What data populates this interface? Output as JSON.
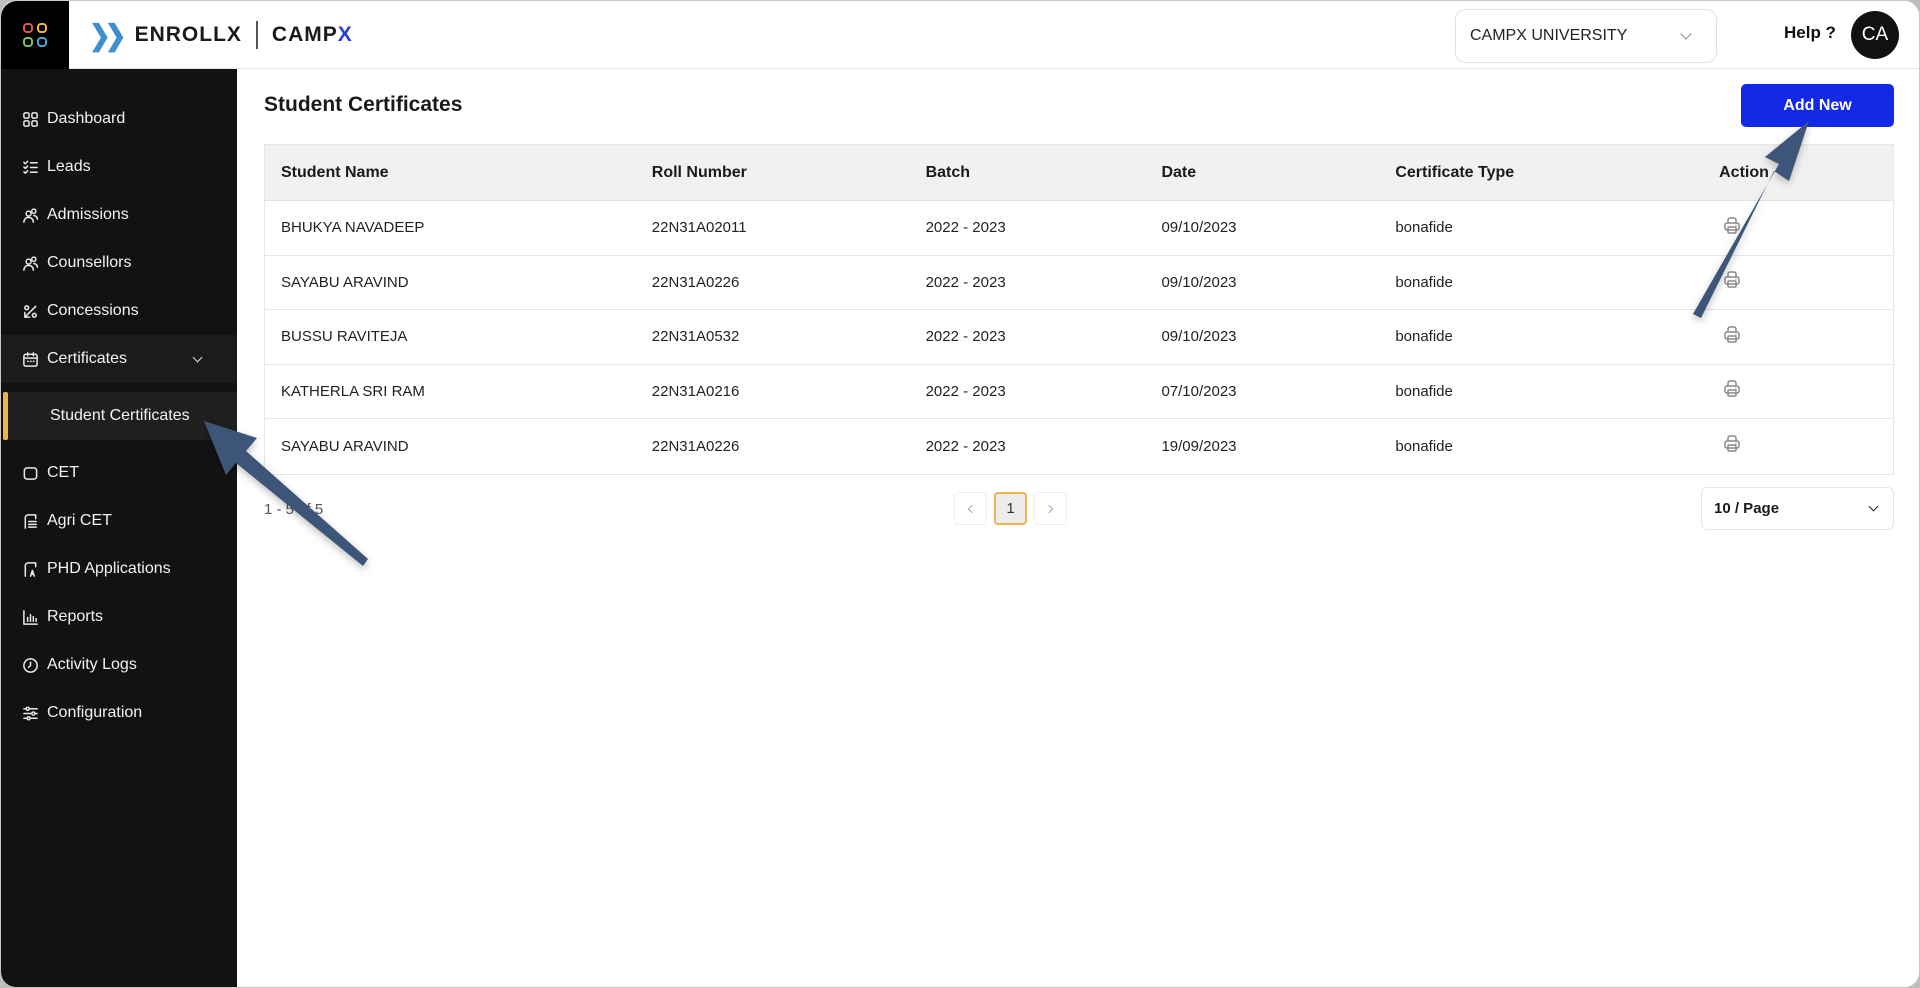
{
  "header": {
    "brand_primary": "ENROLLX",
    "brand_secondary_main": "CAMP",
    "brand_secondary_accent": "X",
    "institution_select": "CAMPX UNIVERSITY",
    "help_label": "Help ?",
    "avatar_initials": "CA"
  },
  "sidebar": {
    "items": [
      {
        "label": "Dashboard",
        "icon": "dashboard-grid-icon"
      },
      {
        "label": "Leads",
        "icon": "checklist-icon"
      },
      {
        "label": "Admissions",
        "icon": "users-icon"
      },
      {
        "label": "Counsellors",
        "icon": "users-icon"
      },
      {
        "label": "Concessions",
        "icon": "percent-icon"
      },
      {
        "label": "Certificates",
        "icon": "calendar-icon",
        "expanded": true
      },
      {
        "label": "Student Certificates",
        "active": true
      },
      {
        "label": "CET",
        "icon": "square-icon"
      },
      {
        "label": "Agri CET",
        "icon": "document-icon"
      },
      {
        "label": "PHD Applications",
        "icon": "document-a-icon"
      },
      {
        "label": "Reports",
        "icon": "bar-chart-icon"
      },
      {
        "label": "Activity Logs",
        "icon": "clock-icon"
      },
      {
        "label": "Configuration",
        "icon": "sliders-icon"
      }
    ]
  },
  "main": {
    "title": "Student Certificates",
    "add_button": "Add New",
    "table": {
      "columns": [
        "Student Name",
        "Roll Number",
        "Batch",
        "Date",
        "Certificate Type",
        "Action"
      ],
      "rows": [
        {
          "name": "BHUKYA NAVADEEP",
          "roll": "22N31A02011",
          "batch": "2022 - 2023",
          "date": "09/10/2023",
          "type": "bonafide"
        },
        {
          "name": "SAYABU ARAVIND",
          "roll": "22N31A0226",
          "batch": "2022 - 2023",
          "date": "09/10/2023",
          "type": "bonafide"
        },
        {
          "name": "BUSSU RAVITEJA",
          "roll": "22N31A0532",
          "batch": "2022 - 2023",
          "date": "09/10/2023",
          "type": "bonafide"
        },
        {
          "name": "KATHERLA SRI RAM",
          "roll": "22N31A0216",
          "batch": "2022 - 2023",
          "date": "07/10/2023",
          "type": "bonafide"
        },
        {
          "name": "SAYABU ARAVIND",
          "roll": "22N31A0226",
          "batch": "2022 - 2023",
          "date": "19/09/2023",
          "type": "bonafide"
        }
      ]
    },
    "pagination": {
      "range_text": "1 - 5 of 5",
      "current_page": "1",
      "page_size": "10 / Page"
    }
  },
  "colors": {
    "sidebar_bg": "#121212",
    "accent_primary": "#1329e6",
    "active_indicator": "#f0b445",
    "annotation_arrow": "#3d5578"
  }
}
